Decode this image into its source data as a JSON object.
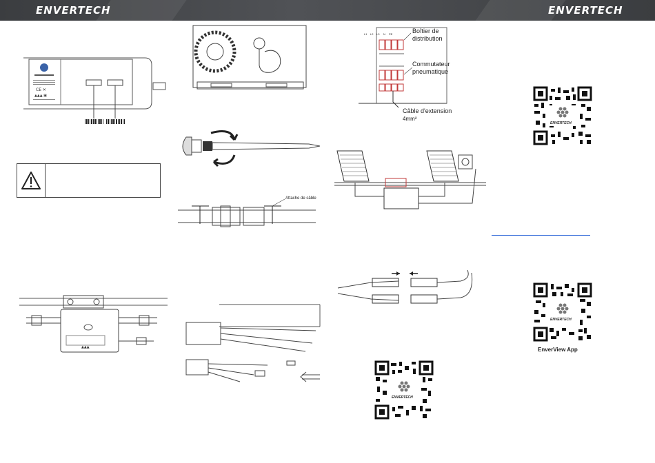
{
  "header": {
    "brand_left": "ENVERTECH",
    "brand_right": "ENVERTECH"
  },
  "labels": {
    "cable_tie": "Attache de câble",
    "distribution_box_l1": "Boîtier de",
    "distribution_box_l2": "distribution",
    "switch_l1": "Commutateur",
    "switch_l2": "pneumatique",
    "extension_cable": "Câble d'extension",
    "cable_section": "4mm²",
    "app_name": "EnverView App",
    "qr_brand": "ENVERTECH",
    "breaker_marks": [
      "L1",
      "L2",
      "L3",
      "N",
      "PE"
    ]
  },
  "icons": {
    "warning": "warning-triangle-icon",
    "rotate": "rotate-arrows-icon",
    "push": "push-arrow-icon"
  },
  "colors": {
    "header_bg": "#45474b",
    "link": "#2a64d8",
    "line": "#333333",
    "breaker_red": "#c23a3a"
  }
}
